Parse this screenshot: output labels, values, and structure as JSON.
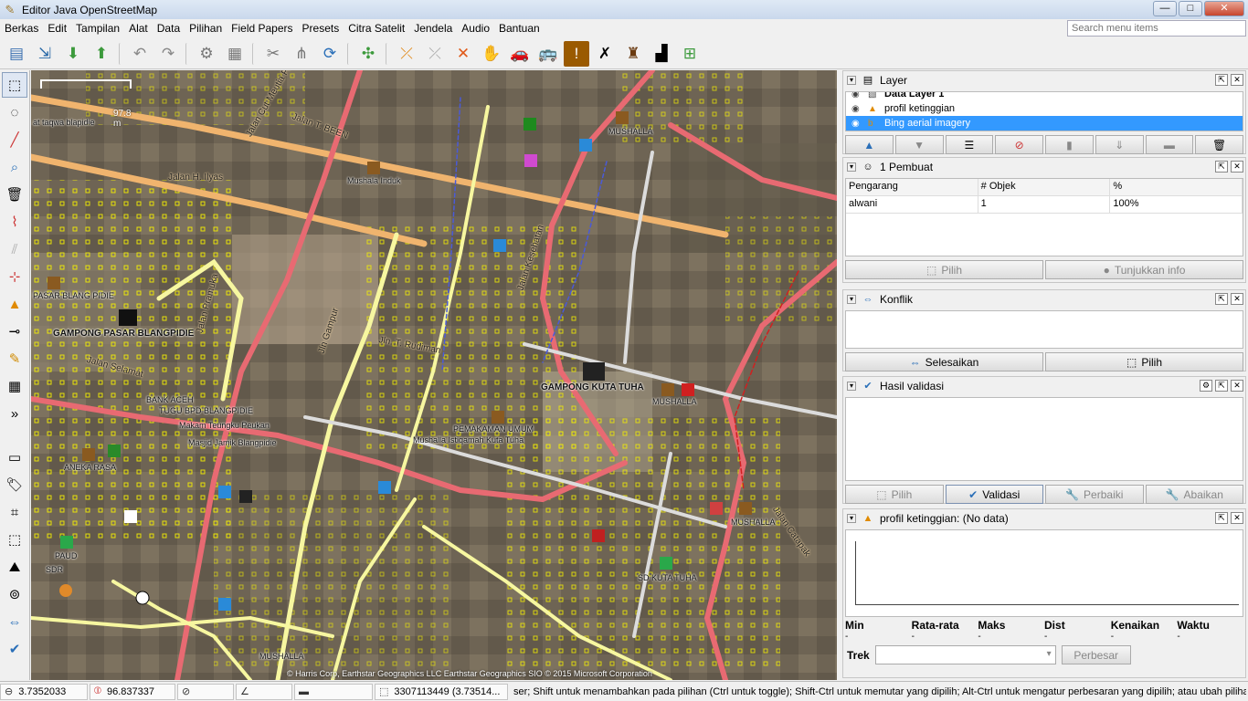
{
  "window": {
    "title": "Editor Java OpenStreetMap",
    "min": "—",
    "max": "□",
    "close": "✕"
  },
  "menu": {
    "items": [
      "Berkas",
      "Edit",
      "Tampilan",
      "Alat",
      "Data",
      "Pilihan",
      "Field Papers",
      "Presets",
      "Citra Satelit",
      "Jendela",
      "Audio",
      "Bantuan"
    ],
    "search_placeholder": "Search menu items"
  },
  "toolbar": {
    "icons": [
      "open-icon",
      "save-icon",
      "download-icon",
      "upload-icon",
      "undo-icon",
      "redo-icon",
      "preferences-icon",
      "tag-editor-icon",
      "split-way-icon",
      "combine-icon",
      "refresh-icon",
      "zoom-fit-icon",
      "highway-icon",
      "path-icon",
      "crossing-icon",
      "hand-icon",
      "car-icon",
      "bus-icon",
      "warning-icon",
      "restaurant-icon",
      "castle-icon",
      "industry-icon",
      "elevation-icon"
    ]
  },
  "map": {
    "scale": "97.8 m",
    "attribution": "© Harris Corp, Earthstar Geographics LLC Earthstar Geographics SIO © 2015 Microsoft Corporation",
    "labels": {
      "jalan_meulaboh_padang": "Jalan Cut Meutia Padang",
      "at_taqwa": "at taqwa blapidie",
      "jalan_t_ben": "Jalan T. BEEN",
      "jalan_h_ilyas": "Jalan H. Ilyas",
      "mushala_induk": "Mushala Induk",
      "mushalla_top": "MUSHALLA",
      "pasar": "PASAR BLANG PIDIE",
      "gampong_pasar": "GAMPONG PASAR BLANGPIDIE",
      "jalan_pramuka": "Jalan Pramuka",
      "jalan_kesehatan": "Jalan Kesehatan",
      "jalan_selamat": "Jalan Selamat",
      "bank_aceh": "BANK ACEH",
      "tugu": "TUGU BPD BLANGPIDIE",
      "makam": "Makam Teungku Peukan",
      "masjid": "Masjid Jamik Blangpidie",
      "gampong_kuta": "GAMPONG KUTA TUHA",
      "mushalla_mid": "MUSHALLA",
      "pemakaman": "PEMAKAMAN UMUM",
      "mushalla_istiqamah": "Mushalla Istiqamah Kuta Tuha",
      "aneka_rasa": "ANEKA RASA",
      "paud": "PAUD",
      "sdr": "SDR",
      "sd_kuta": "SD KUTA TUHA",
      "mushalla_right": "MUSHALLA",
      "mushalla_bottom": "MUSHALLA",
      "jln_gampur": "Jln Gampur",
      "jln_t_rudiman": "Jln. T. Rudiman",
      "jalan_kampus": "Jalan Catapak"
    }
  },
  "panels": {
    "layer": {
      "title": "Layer",
      "rows": [
        {
          "name": "Data Layer 1",
          "bold": true
        },
        {
          "name": "profil ketinggian"
        },
        {
          "name": "Bing aerial imagery",
          "selected": true
        }
      ]
    },
    "authors": {
      "title": "1 Pembuat",
      "headers": [
        "Pengarang",
        "# Objek",
        "%"
      ],
      "rows": [
        [
          "alwani",
          "1",
          "100%"
        ]
      ],
      "btn_select": "Pilih",
      "btn_info": "Tunjukkan info"
    },
    "conflict": {
      "title": "Konflik",
      "btn_resolve": "Selesaikan",
      "btn_select": "Pilih"
    },
    "validation": {
      "title": "Hasil validasi",
      "btn_select": "Pilih",
      "btn_validate": "Validasi",
      "btn_fix": "Perbaiki",
      "btn_ignore": "Abaikan"
    },
    "elevation": {
      "title": "profil ketinggian: (No data)",
      "headers": [
        "Min",
        "Rata-rata",
        "Maks",
        "Dist",
        "Kenaikan",
        "Waktu"
      ],
      "values": [
        "-",
        "-",
        "-",
        "-",
        "-",
        "-"
      ],
      "trek_label": "Trek",
      "btn": "Perbesar"
    }
  },
  "status": {
    "lat": "3.7352033",
    "lon": "96.837337",
    "heading": "",
    "angle": "",
    "length": "",
    "obj": "3307113449 (3.73514...",
    "help": "ser; Shift untuk menambahkan pada pilihan (Ctrl untuk toggle); Shift-Ctrl untuk memutar yang dipilih; Alt-Ctrl untuk mengatur perbesaran yang dipilih; atau ubah pilihan."
  }
}
